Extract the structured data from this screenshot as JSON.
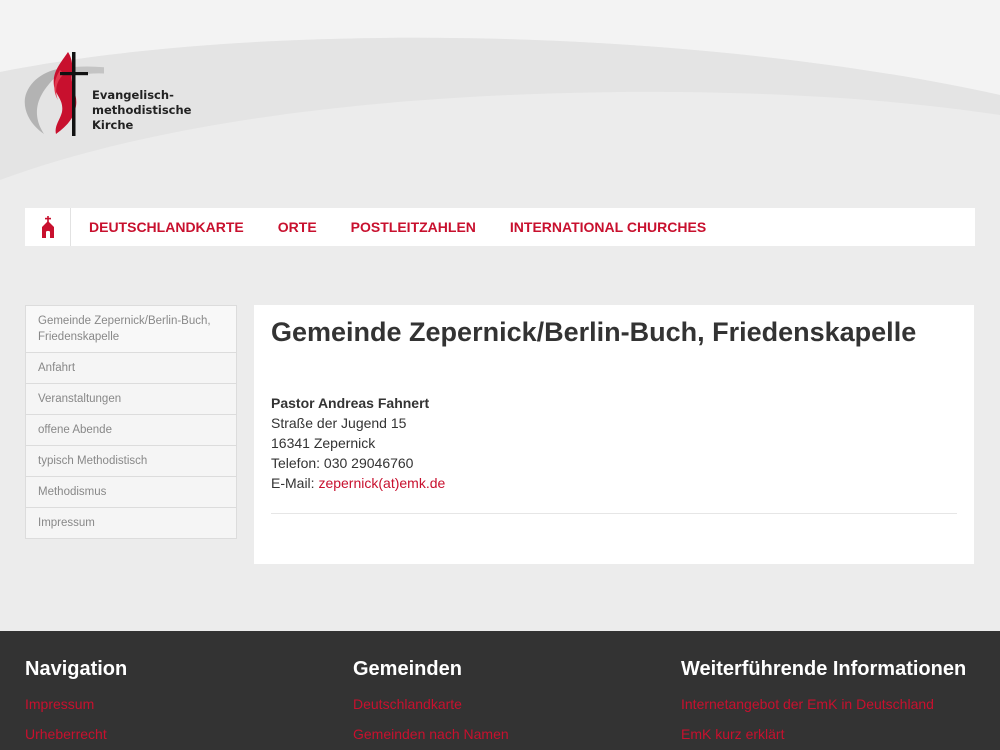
{
  "logo": {
    "line1": "Evangelisch-",
    "line2": "methodistische",
    "line3": "Kirche"
  },
  "nav": {
    "items": [
      {
        "label": "DEUTSCHLANDKARTE"
      },
      {
        "label": "ORTE"
      },
      {
        "label": "POSTLEITZAHLEN"
      },
      {
        "label": "INTERNATIONAL CHURCHES"
      }
    ]
  },
  "sidebar": {
    "items": [
      {
        "label": "Gemeinde Zepernick/Berlin-Buch, Friedenskapelle"
      },
      {
        "label": "Anfahrt"
      },
      {
        "label": "Veranstaltungen"
      },
      {
        "label": "offene Abende"
      },
      {
        "label": "typisch Methodistisch"
      },
      {
        "label": "Methodismus"
      },
      {
        "label": "Impressum"
      }
    ]
  },
  "content": {
    "title": "Gemeinde Zepernick/Berlin-Buch, Friedenskapelle",
    "pastor": "Pastor Andreas Fahnert",
    "street": "Straße der Jugend 15",
    "city": "16341 Zepernick",
    "phone": "Telefon: 030 29046760",
    "email_label": "E-Mail: ",
    "email": "zepernick(at)emk.de"
  },
  "footer": {
    "columns": [
      {
        "title": "Navigation",
        "links": [
          "Impressum",
          "Urheberrecht"
        ]
      },
      {
        "title": "Gemeinden",
        "links": [
          "Deutschlandkarte",
          "Gemeinden nach Namen"
        ]
      },
      {
        "title": "Weiterführende Informationen",
        "links": [
          "Internetangebot der EmK in Deutschland",
          "EmK kurz erklärt"
        ]
      }
    ]
  },
  "colors": {
    "accent": "#c8102e",
    "background": "#ececec",
    "footer": "#333333"
  },
  "icons": {
    "home": "church-icon",
    "logo": "cross-and-flame-logo"
  }
}
